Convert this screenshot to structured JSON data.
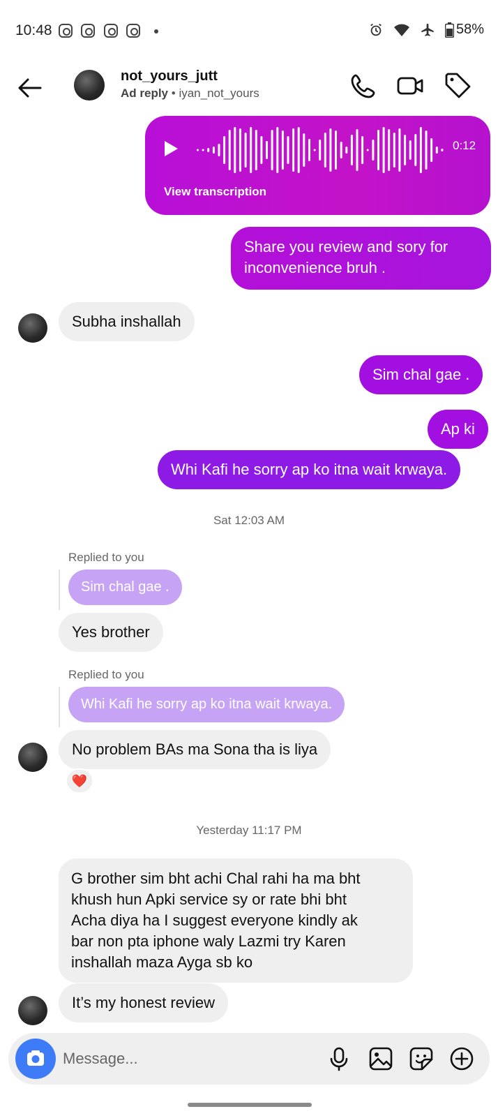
{
  "status_bar": {
    "time": "10:48",
    "battery": "58%"
  },
  "header": {
    "contact_name": "not_yours_jutt",
    "sub_label": "Ad reply",
    "sub_separator": " • ",
    "sub_user": "iyan_not_yours"
  },
  "voice_message": {
    "duration": "0:12",
    "transcription_label": "View transcription"
  },
  "messages": {
    "m1": "Share you review and sory for",
    "m1b": "inconvenience bruh .",
    "m2": "Subha inshallah",
    "m3": "Sim chal gae .",
    "m4": "Ap ki",
    "m5": "Whi Kafi he sorry ap ko itna wait krwaya.",
    "stamp1": "Sat 12:03 AM",
    "replied1": "Replied to you",
    "quote1": "Sim chal gae .",
    "m6": "Yes brother",
    "replied2": "Replied to you",
    "quote2": "Whi Kafi he sorry ap ko itna wait krwaya.",
    "m7": "No problem BAs ma Sona tha is liya",
    "reaction": "❤️",
    "stamp2": "Yesterday 11:17 PM",
    "m8_l1": "G brother sim bht achi Chal rahi ha  ma bht",
    "m8_l2": "khush hun Apki service sy or rate bhi bht",
    "m8_l3": "Acha diya ha I suggest everyone kindly ak",
    "m8_l4": "bar non pta iphone waly Lazmi try Karen",
    "m8_l5": "inshallah maza Ayga sb ko",
    "m9": "It’s my honest review"
  },
  "composer": {
    "placeholder": "Message..."
  },
  "colors": {
    "outgoing": "#a30fe0",
    "voice_bubble": "#c313c8",
    "incoming": "#efefef",
    "quoted_reply": "#c7a3f6",
    "camera_button": "#3d7bf7"
  }
}
